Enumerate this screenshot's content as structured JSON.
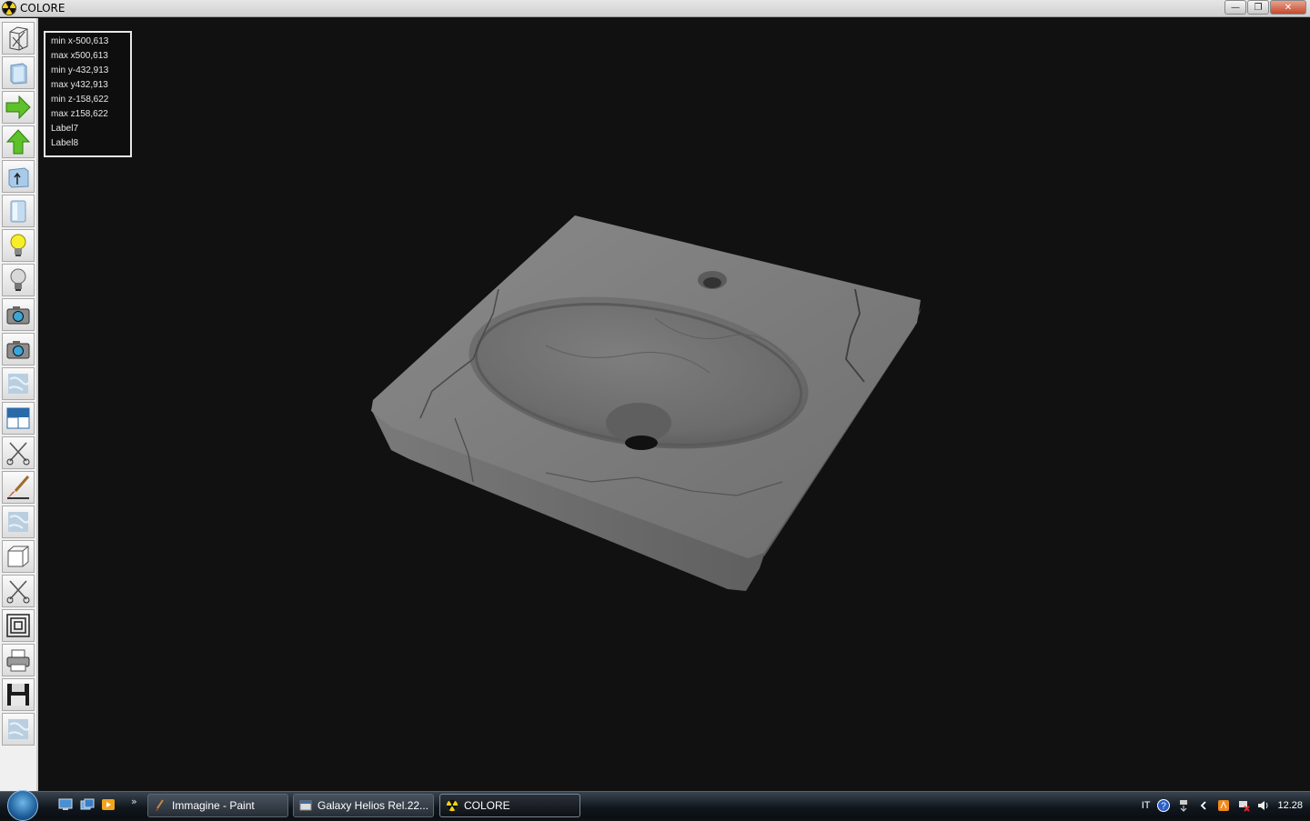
{
  "window": {
    "title": "COLORE",
    "minimize": "—",
    "restore": "❐",
    "close": "✕"
  },
  "toolbar": {
    "icons": [
      "wireframe-box-icon",
      "solid-box-icon",
      "arrow-right-icon",
      "arrow-up-icon",
      "box-with-arrow-icon",
      "glass-box-icon",
      "lightbulb-on-icon",
      "lightbulb-off-icon",
      "camera-icon",
      "camera-icon",
      "texture-icon",
      "window-split-icon",
      "scissors-icon",
      "paintbrush-icon",
      "texture-icon",
      "cube-icon",
      "scissors-icon",
      "concentric-squares-icon",
      "printer-icon",
      "floppy-disk-icon",
      "texture-icon"
    ]
  },
  "info": {
    "lines": [
      "min x-500,613",
      "max x500,613",
      "min y-432,913",
      "max y432,913",
      "min z-158,622",
      "max z158,622",
      "Label7",
      "Label8"
    ]
  },
  "taskbar": {
    "chevron": "»",
    "tasks": [
      {
        "label": "Immagine - Paint",
        "icon": "paint-icon"
      },
      {
        "label": "Galaxy Helios  Rel.22...",
        "icon": "window-icon"
      },
      {
        "label": "COLORE",
        "icon": "radiation-icon",
        "active": true
      }
    ],
    "tray": {
      "language": "IT",
      "help": "?",
      "clock": "12.28"
    }
  }
}
